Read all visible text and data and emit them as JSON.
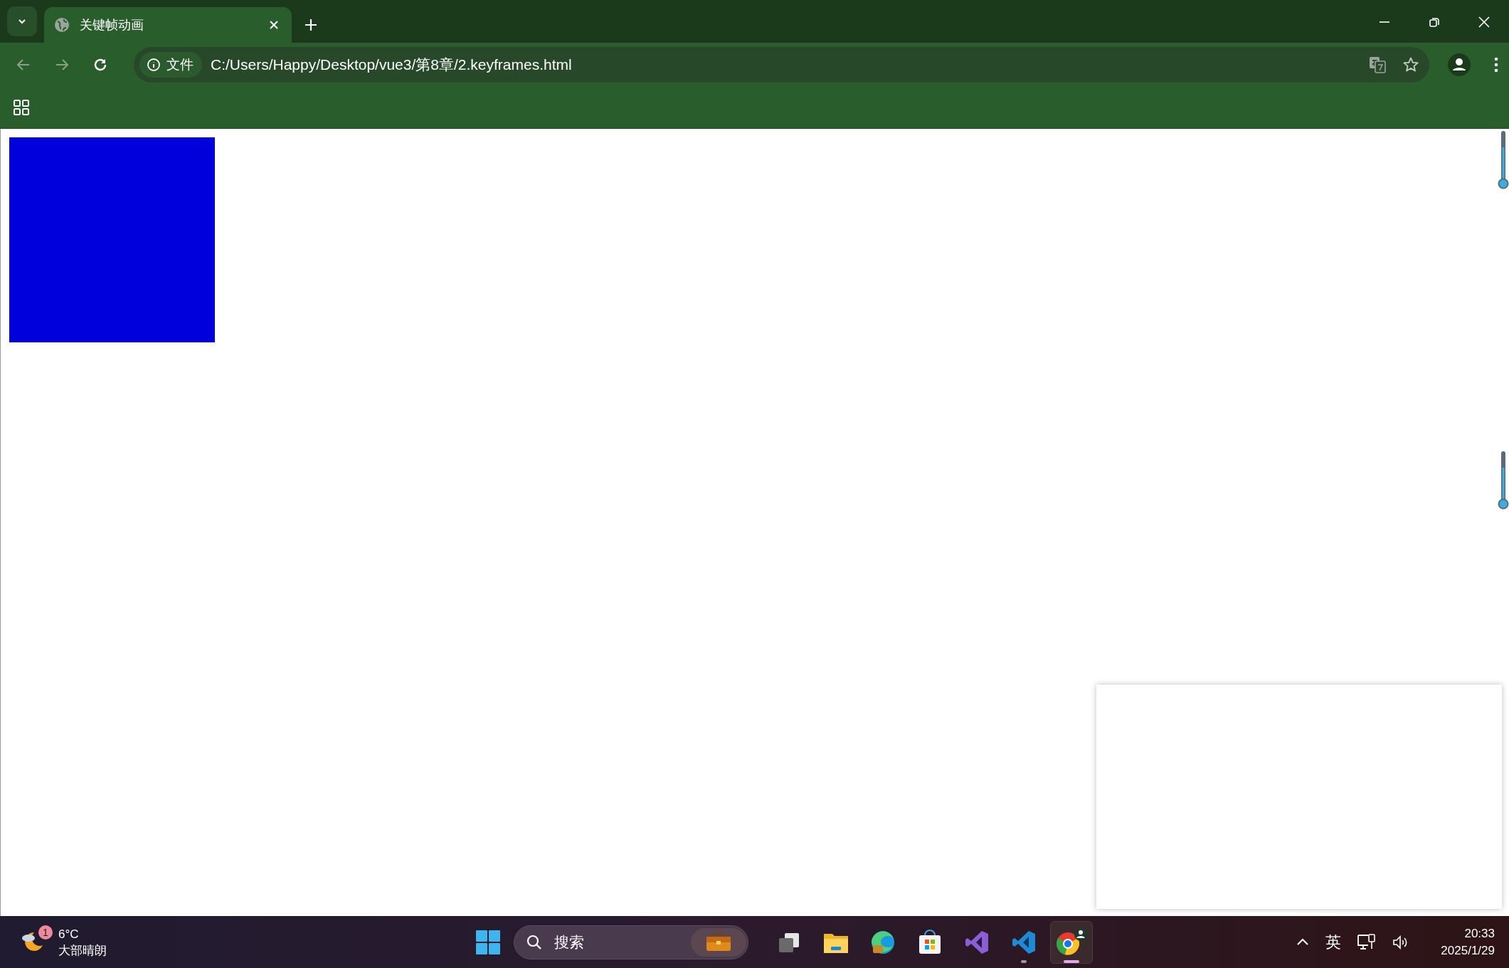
{
  "window": {
    "tab": {
      "title": "关键帧动画",
      "selected": true
    }
  },
  "address_bar": {
    "security_label": "文件",
    "url": "C:/Users/Happy/Desktop/vue3/第8章/2.keyframes.html"
  },
  "taskbar": {
    "weather": {
      "badge": "1",
      "temperature": "6°C",
      "condition": "大部晴朗"
    },
    "search": {
      "placeholder": "搜索"
    },
    "apps": [
      {
        "kind": "taskview",
        "running": false,
        "selected": false
      },
      {
        "kind": "explorer",
        "running": false,
        "selected": false
      },
      {
        "kind": "edge",
        "running": false,
        "selected": false
      },
      {
        "kind": "store",
        "running": false,
        "selected": false
      },
      {
        "kind": "visualstudio",
        "running": false,
        "selected": false
      },
      {
        "kind": "vscode",
        "running": true,
        "selected": false
      },
      {
        "kind": "chrome",
        "running": true,
        "selected": true
      }
    ],
    "input_method": "英",
    "time": "20:33",
    "date": "2025/1/29"
  }
}
